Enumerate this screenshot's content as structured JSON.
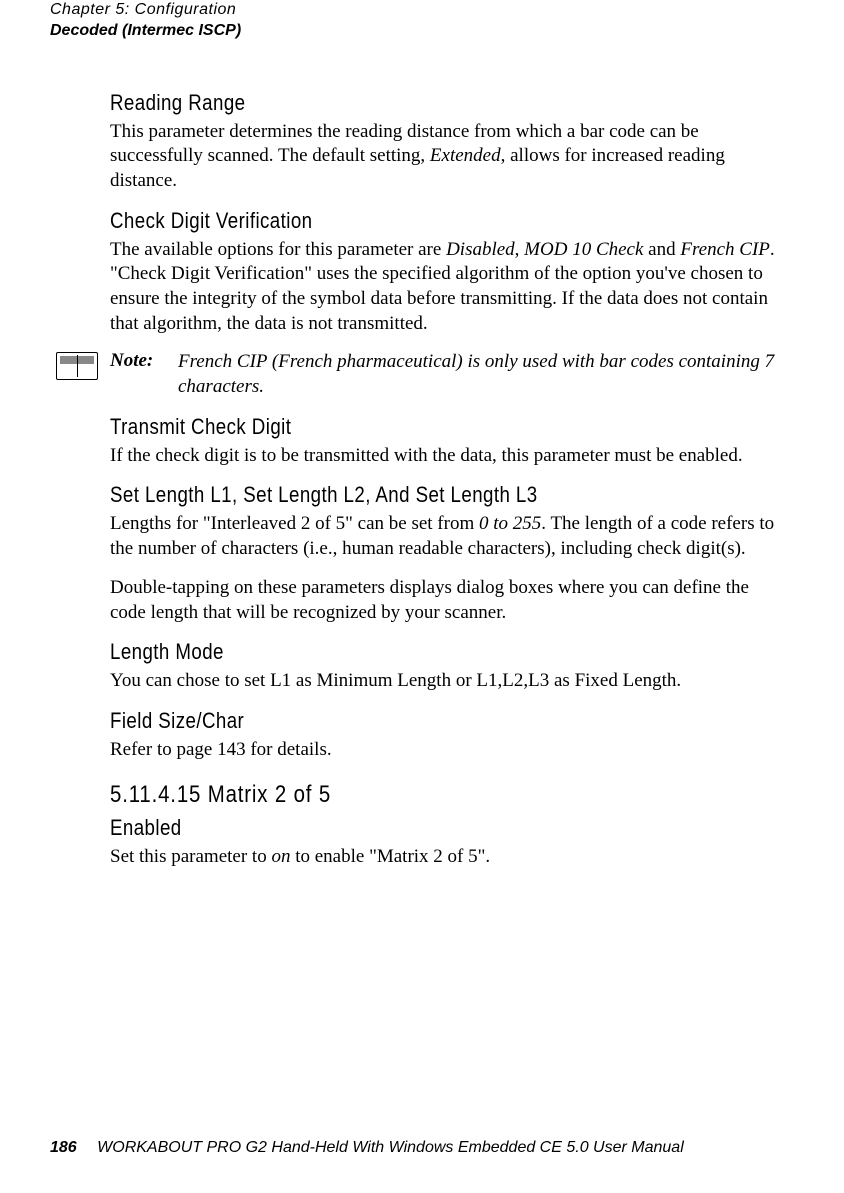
{
  "header": {
    "chapter": "Chapter 5: Configuration",
    "section": "Decoded (Intermec ISCP)"
  },
  "readingRange": {
    "title": "Reading Range",
    "body_pre": "This parameter determines the reading distance from which a bar code can be successfully scanned. The default setting, ",
    "body_em": "Extended",
    "body_post": ", allows for increased reading distance."
  },
  "checkDigit": {
    "title": "Check Digit Verification",
    "body_pre": "The available options for this parameter are ",
    "em1": "Disabled",
    "mid1": ", ",
    "em2": "MOD 10 Check",
    "mid2": " and ",
    "em3": "French CIP",
    "body_post": ". \"Check Digit Verification\" uses the specified algorithm of the option you've chosen to ensure the integrity of the symbol data before transmitting. If the data does not contain that algorithm, the data is not transmitted."
  },
  "note": {
    "label": "Note:",
    "body": "French CIP (French pharmaceutical) is only used with bar codes containing 7 characters."
  },
  "transmitCheckDigit": {
    "title": "Transmit Check Digit",
    "body": "If the check digit is to be transmitted with the data, this parameter must be enabled."
  },
  "setLength": {
    "title": "Set Length L1, Set Length L2, And Set Length L3",
    "body_pre": "Lengths for \"Interleaved 2 of 5\" can be set from ",
    "em": "0 to 255",
    "body_post": ". The length of a code refers to the number of characters (i.e., human readable characters), including check digit(s).",
    "body2": "Double-tapping on these parameters displays dialog boxes where you can define the code length that will be recognized by your scanner."
  },
  "lengthMode": {
    "title": "Length Mode",
    "body": "You can chose to set L1 as Minimum Length or L1,L2,L3 as Fixed Length."
  },
  "fieldSize": {
    "title": "Field Size/Char",
    "body": "Refer to page 143 for details."
  },
  "matrix": {
    "title": "5.11.4.15 Matrix 2 of 5"
  },
  "enabled": {
    "title": "Enabled",
    "body_pre": "Set this parameter to ",
    "em": "on",
    "body_post": " to enable \"Matrix 2 of 5\"."
  },
  "footer": {
    "page": "186",
    "title": "WORKABOUT PRO G2 Hand-Held With Windows Embedded CE 5.0 User Manual"
  }
}
